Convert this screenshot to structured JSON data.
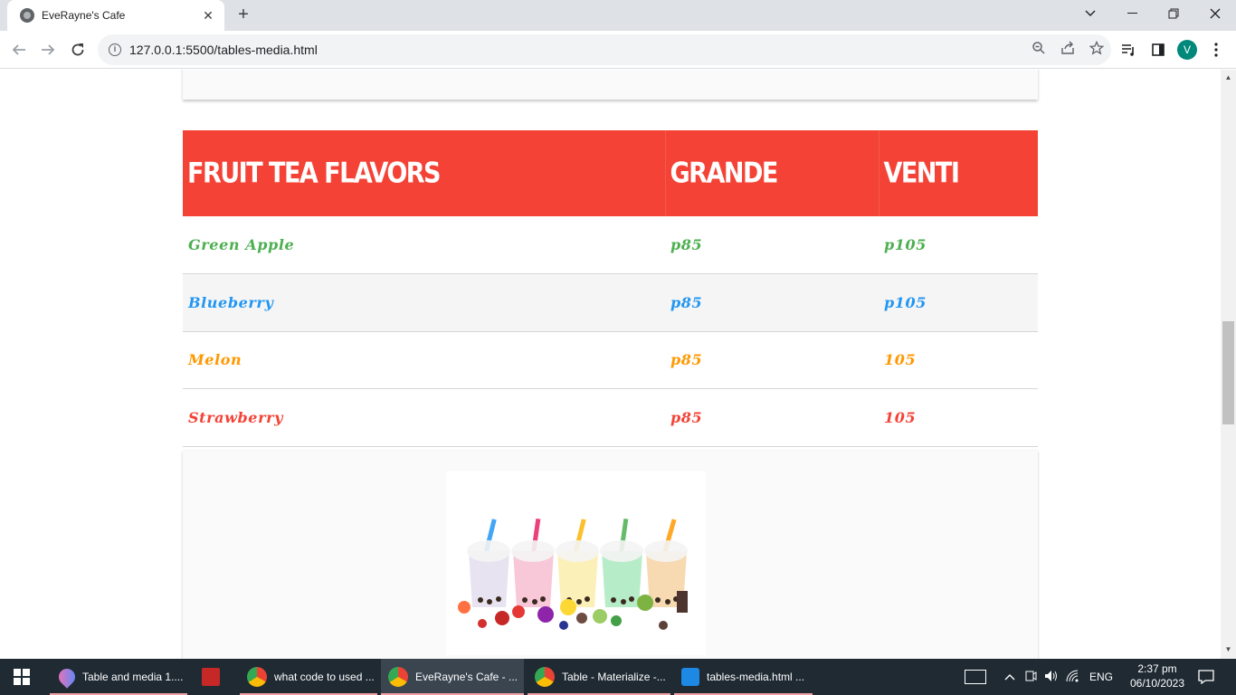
{
  "browser": {
    "tab_title": "EveRayne's Cafe",
    "url": "127.0.0.1:5500/tables-media.html",
    "profile_initial": "V"
  },
  "table": {
    "headers": [
      "FRUIT TEA FLAVORS",
      "GRANDE",
      "VENTI"
    ],
    "header_color": "#f44336",
    "rows": [
      {
        "flavor": "Green Apple",
        "grande": "p85",
        "venti": "p105",
        "color": "#4caf50"
      },
      {
        "flavor": "Blueberry",
        "grande": "p85",
        "venti": "p105",
        "color": "#2196f3"
      },
      {
        "flavor": "Melon",
        "grande": "p85",
        "venti": "105",
        "color": "#ff9800"
      },
      {
        "flavor": "Strawberry",
        "grande": "p85",
        "venti": "105",
        "color": "#f44336"
      }
    ]
  },
  "taskbar": {
    "items": [
      {
        "label": "Table and media 1....",
        "icon": "paint-drop-icon"
      },
      {
        "label": "",
        "icon": "chart-app-icon"
      },
      {
        "label": "what code to used ...",
        "icon": "chrome-icon"
      },
      {
        "label": "EveRayne's Cafe - ...",
        "icon": "chrome-icon"
      },
      {
        "label": "Table - Materialize -...",
        "icon": "chrome-icon"
      },
      {
        "label": "tables-media.html ...",
        "icon": "vscode-icon"
      }
    ],
    "language": "ENG",
    "time": "2:37 pm",
    "date": "06/10/2023"
  }
}
